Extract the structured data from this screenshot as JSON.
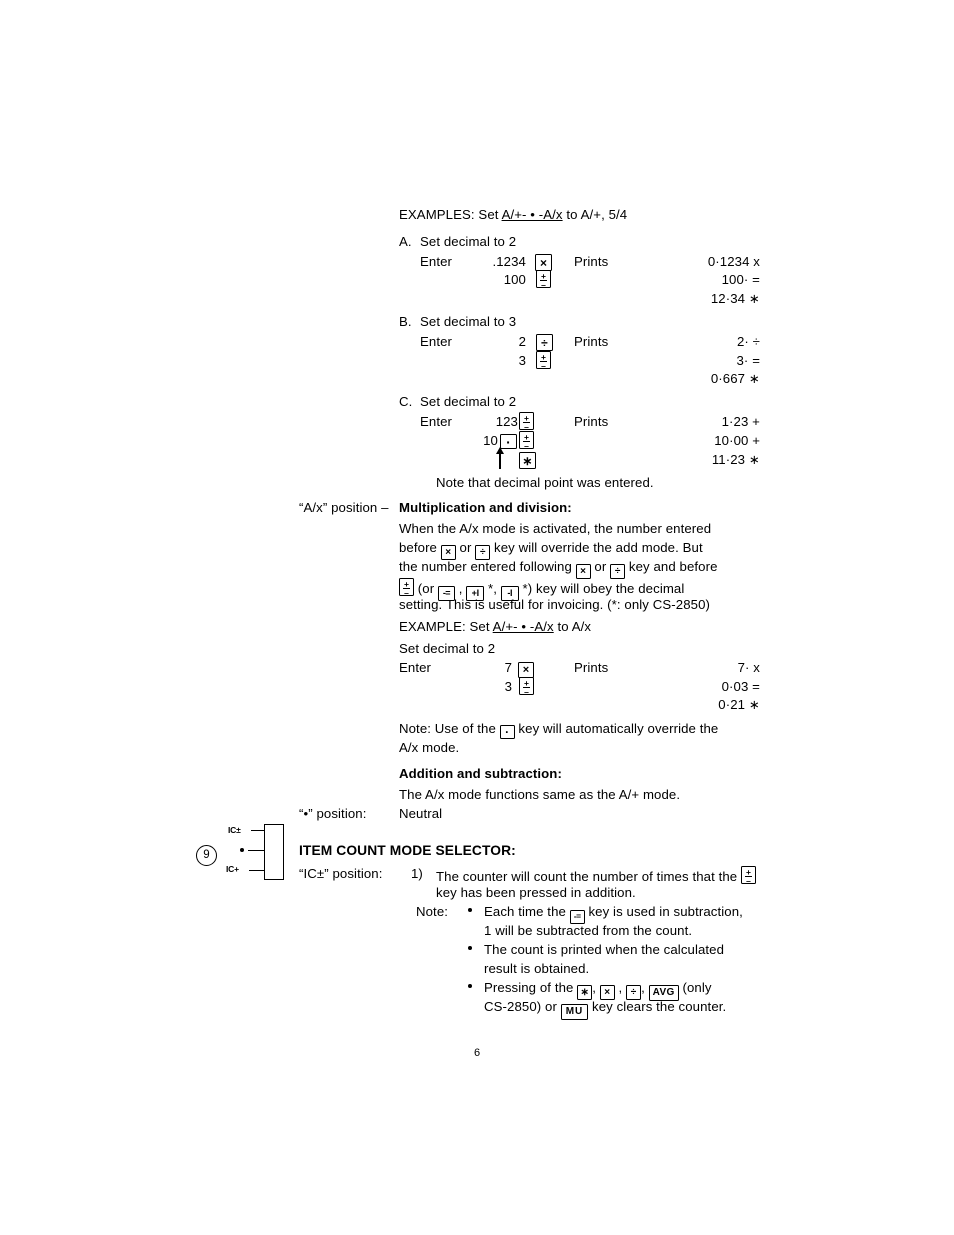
{
  "page": {
    "number": "6",
    "document_type": "calculator-manual-page"
  },
  "examples_block": {
    "heading_prefix": "EXAMPLES: Set ",
    "heading_switch": "A/+- • -A/x",
    "heading_suffix": " to A/+, 5/4",
    "items": [
      {
        "label": "A.",
        "title": "Set decimal to 2",
        "enter_label": "Enter",
        "prints_label": "Prints",
        "entries": [
          {
            "value": ".1234",
            "key": "x"
          },
          {
            "value": "100",
            "key": "plusminus"
          }
        ],
        "prints": [
          "0·1234 x",
          "100· =",
          "12·34 ∗"
        ]
      },
      {
        "label": "B.",
        "title": "Set decimal to 3",
        "enter_label": "Enter",
        "prints_label": "Prints",
        "entries": [
          {
            "value": "2",
            "key": "divide"
          },
          {
            "value": "3",
            "key": "plusminus"
          }
        ],
        "prints": [
          "2· ÷",
          "3· =",
          "0·667 ∗"
        ]
      },
      {
        "label": "C.",
        "title": "Set decimal to 2",
        "enter_label": "Enter",
        "prints_label": "Prints",
        "entries": [
          {
            "value": "123",
            "key": "plusminus"
          },
          {
            "value": "10",
            "key": "dot-plusminus"
          },
          {
            "value": "",
            "key": "asterisk"
          }
        ],
        "prints": [
          "1·23 +",
          "10·00 +",
          "11·23 ∗"
        ]
      }
    ],
    "footnote": "Note that decimal point was entered."
  },
  "ax_section": {
    "position_label": "“A/x” position –",
    "heading": "Multiplication and division:",
    "body_lines": [
      {
        "pre": "When the A/x mode is activated, the number entered"
      },
      {
        "pre": "before ",
        "key1": "x",
        "mid": " or ",
        "key2": "divide",
        "post": " key will override the add mode. But"
      },
      {
        "pre": "the number entered following ",
        "key1": "x",
        "mid": " or ",
        "key2": "divide",
        "post": " key and before"
      },
      {
        "pre": "",
        "key1": "plusminus",
        "mid": " (or ",
        "key2": "minus-equals",
        "k2sep": " , ",
        "key3": "plus-i",
        "k3sep": " *, ",
        "key4": "minus-i",
        "post": " *) key will obey the decimal"
      },
      {
        "pre": "setting.  This is useful for invoicing. (*: only CS-2850)"
      }
    ],
    "example": {
      "heading_prefix": "EXAMPLE: Set ",
      "heading_switch": "A/+- • -A/x",
      "heading_suffix": " to A/x",
      "decimal_line": "Set decimal to 2",
      "enter_label": "Enter",
      "prints_label": "Prints",
      "entries": [
        {
          "value": "7",
          "key": "x"
        },
        {
          "value": "3",
          "key": "plusminus"
        }
      ],
      "prints": [
        "7· x",
        "0·03 =",
        "0·21 ∗"
      ]
    },
    "note": {
      "pre": "Note:  Use of the ",
      "key": "dot",
      "post": " key will automatically override the",
      "line2": "A/x mode."
    },
    "addition_heading": "Addition and subtraction:",
    "addition_body": "The A/x mode functions same as the A/+ mode.",
    "neutral_position_label": "“•” position:",
    "neutral_value": "Neutral"
  },
  "item_count_section": {
    "callout_number": "9",
    "selector": {
      "top_label": "IC±",
      "mid_label": "•",
      "bottom_label": "IC+"
    },
    "heading": "ITEM COUNT MODE SELECTOR:",
    "position_label": "“IC±” position:",
    "point1": {
      "marker": "1)",
      "pre": "The counter will count the number of times that the ",
      "key": "plusminus",
      "line2": "key has been pressed in addition."
    },
    "note_label": "Note:",
    "bullets": [
      {
        "pre": "Each time the ",
        "key": "minus-equals",
        "post": " key is used in subtraction,",
        "line2": "1 will be subtracted from the count."
      },
      {
        "line1": "The count is printed when the calculated",
        "line2": "result is obtained."
      },
      {
        "pre": "Pressing of the ",
        "key1": "asterisk",
        "sep1": ", ",
        "key2": "x",
        "sep2": " , ",
        "key3": "divide",
        "sep3": ", ",
        "key4": "avg",
        "post": " (only",
        "line2_pre": "CS-2850) or ",
        "line2_key": "mu",
        "line2_post": " key clears the counter."
      }
    ]
  },
  "keys": {
    "x": "×",
    "divide": "÷",
    "dot": "·",
    "asterisk": "∗",
    "avg": "AVG",
    "mu": "MU",
    "minus_equals": "-=",
    "plus_i": "+I",
    "minus_i": "-I"
  },
  "colors": {
    "ink": "#000000",
    "paper": "#ffffff"
  }
}
